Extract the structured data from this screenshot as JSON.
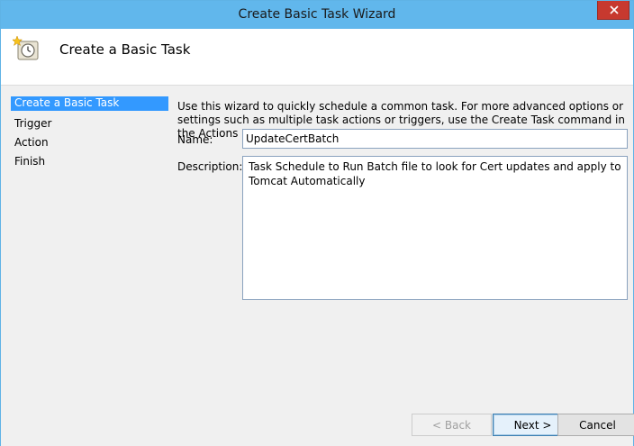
{
  "window": {
    "title": "Create Basic Task Wizard"
  },
  "header": {
    "title": "Create a Basic Task",
    "icon": "task-scheduler-clock-icon"
  },
  "steps": [
    {
      "label": "Create a Basic Task",
      "active": true
    },
    {
      "label": "Trigger",
      "active": false
    },
    {
      "label": "Action",
      "active": false
    },
    {
      "label": "Finish",
      "active": false
    }
  ],
  "form": {
    "intro": "Use this wizard to quickly schedule a common task.  For more advanced options or settings such as multiple task actions or triggers, use the Create Task command in the Actions pane.",
    "name_label": "Name:",
    "name_value": "UpdateCertBatch",
    "description_label": "Description:",
    "description_value": "Task Schedule to Run Batch file to look for Cert updates and apply to Tomcat Automatically"
  },
  "buttons": {
    "back": "< Back",
    "next": "Next >",
    "cancel": "Cancel"
  },
  "colors": {
    "titlebar": "#61b7ec",
    "close": "#c7392f",
    "selection": "#3399ff",
    "panel": "#f0f0f0"
  }
}
